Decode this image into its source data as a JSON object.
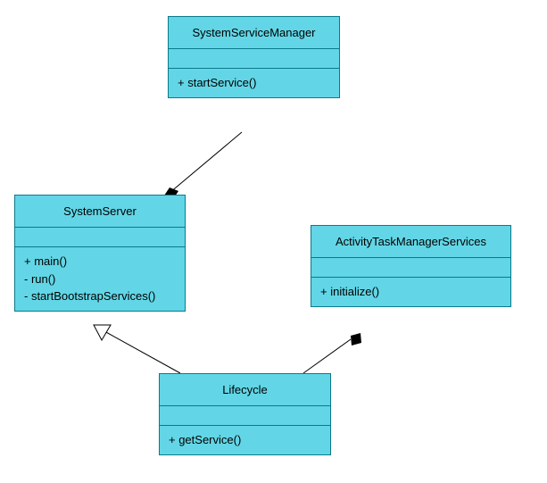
{
  "classes": {
    "ssm": {
      "name": "SystemServiceManager",
      "ops": [
        "+  startService()"
      ]
    },
    "ss": {
      "name": "SystemServer",
      "ops": [
        "+  main()",
        "-   run()",
        "-   startBootstrapServices()"
      ]
    },
    "atms": {
      "name": "ActivityTaskManagerServices",
      "ops": [
        "+  initialize()"
      ]
    },
    "lc": {
      "name": "Lifecycle",
      "ops": [
        "+  getService()"
      ]
    }
  },
  "relations": [
    {
      "from": "ss",
      "to": "ssm",
      "type": "composition",
      "diamond_at": "from"
    },
    {
      "from": "atms",
      "to": "lc",
      "type": "composition",
      "diamond_at": "from"
    },
    {
      "from": "lc",
      "to": "ss",
      "type": "generalization",
      "arrow_at": "to"
    }
  ],
  "chart_data": {
    "type": "uml-class-diagram",
    "classes": [
      {
        "name": "SystemServiceManager",
        "attributes": [],
        "operations": [
          {
            "vis": "+",
            "sig": "startService()"
          }
        ]
      },
      {
        "name": "SystemServer",
        "attributes": [],
        "operations": [
          {
            "vis": "+",
            "sig": "main()"
          },
          {
            "vis": "-",
            "sig": "run()"
          },
          {
            "vis": "-",
            "sig": "startBootstrapServices()"
          }
        ]
      },
      {
        "name": "ActivityTaskManagerServices",
        "attributes": [],
        "operations": [
          {
            "vis": "+",
            "sig": "initialize()"
          }
        ]
      },
      {
        "name": "Lifecycle",
        "attributes": [],
        "operations": [
          {
            "vis": "+",
            "sig": "getService()"
          }
        ]
      }
    ],
    "relationships": [
      {
        "type": "composition",
        "whole": "SystemServer",
        "part": "SystemServiceManager"
      },
      {
        "type": "composition",
        "whole": "ActivityTaskManagerServices",
        "part": "Lifecycle"
      },
      {
        "type": "generalization",
        "child": "Lifecycle",
        "parent": "SystemServer"
      }
    ]
  }
}
